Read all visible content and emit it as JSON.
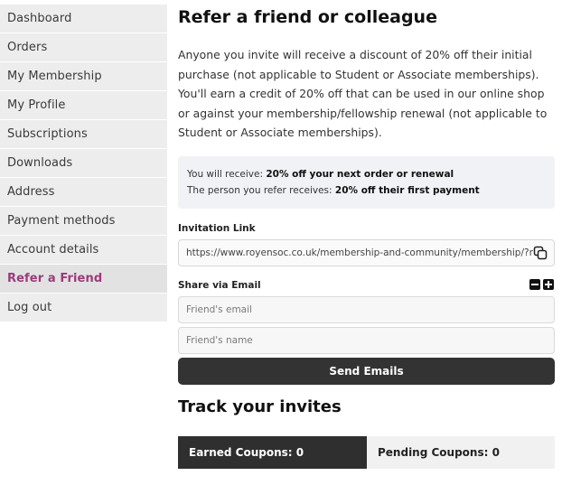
{
  "sidebar": {
    "items": [
      {
        "label": "Dashboard"
      },
      {
        "label": "Orders"
      },
      {
        "label": "My Membership"
      },
      {
        "label": "My Profile"
      },
      {
        "label": "Subscriptions"
      },
      {
        "label": "Downloads"
      },
      {
        "label": "Address"
      },
      {
        "label": "Payment methods"
      },
      {
        "label": "Account details"
      },
      {
        "label": "Refer a Friend"
      },
      {
        "label": "Log out"
      }
    ],
    "active_color": "#9b3b7a"
  },
  "main": {
    "title": "Refer a friend or colleague",
    "intro": "Anyone you invite will receive a discount of 20% off their initial purchase (not applicable to Student or Associate memberships). You'll earn a credit of 20% off that can be used in our online shop or against your membership/fellowship renewal (not applicable to Student or Associate memberships).",
    "info": {
      "receive_prefix": "You will receive: ",
      "receive_value": "20% off your next order or renewal",
      "refer_prefix": "The person you refer receives: ",
      "refer_value": "20% off their first payment"
    },
    "invitation_label": "Invitation Link",
    "invitation_link": "https://www.royensoc.co.uk/membership-and-community/membership/?r",
    "share_label": "Share via Email",
    "friend_email_placeholder": "Friend's email",
    "friend_name_placeholder": "Friend's name",
    "send_button": "Send Emails",
    "track_title": "Track your invites",
    "tabs": {
      "earned": "Earned Coupons: 0",
      "pending": "Pending Coupons: 0"
    }
  },
  "icons": {
    "copy": "copy-icon",
    "minus": "minus-icon",
    "plus": "plus-icon"
  }
}
